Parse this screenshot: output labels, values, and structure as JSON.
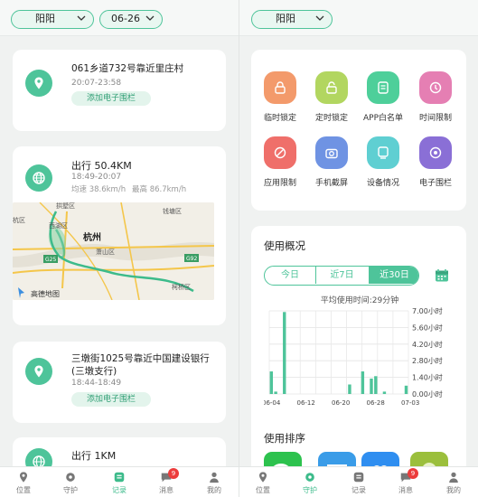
{
  "left": {
    "city": "阳阳",
    "date": "06-26",
    "timeline": [
      {
        "kind": "place",
        "address": "061乡道732号靠近里庄村",
        "time": "20:07-23:58",
        "fence_label": "添加电子围栏"
      },
      {
        "kind": "trip",
        "title": "出行 50.4KM",
        "time": "18:49-20:07",
        "speed_avg": "均速 38.6km/h",
        "speed_max": "最高 86.7km/h",
        "map": {
          "labels": [
            "拱墅区",
            "杭州",
            "西湖区",
            "萧山区",
            "钱塘区",
            "柯桥区",
            "G25",
            "G92"
          ],
          "ghost_labels": [
            "杭区"
          ],
          "logo": "高德地图"
        }
      },
      {
        "kind": "place",
        "address": "三墩街1025号靠近中国建设银行(三墩支行)",
        "time": "18:44-18:49",
        "fence_label": "添加电子围栏"
      },
      {
        "kind": "trip",
        "title": "出行 1KM",
        "time": ""
      }
    ]
  },
  "right": {
    "name": "阳阳",
    "tools": [
      {
        "label": "临时锁定",
        "icon": "lock-icon",
        "color": "#f39a6b"
      },
      {
        "label": "定时锁定",
        "icon": "timed-lock-icon",
        "color": "#b2d660"
      },
      {
        "label": "APP白名单",
        "icon": "whitelist-icon",
        "color": "#4ecf9a"
      },
      {
        "label": "时间限制",
        "icon": "clock-icon",
        "color": "#e57fb3"
      },
      {
        "label": "应用限制",
        "icon": "app-limit-icon",
        "color": "#ef6f6a"
      },
      {
        "label": "手机截屏",
        "icon": "camera-icon",
        "color": "#6f93e3"
      },
      {
        "label": "设备情况",
        "icon": "device-icon",
        "color": "#5fcfd2"
      },
      {
        "label": "电子围栏",
        "icon": "fence-icon",
        "color": "#8a6fd6"
      }
    ],
    "usage": {
      "title": "使用概况",
      "tabs": [
        "今日",
        "近7日",
        "近30日"
      ],
      "active_tab": 2,
      "avg_text": "平均使用时间:29分钟",
      "ranking_title": "使用排序"
    }
  },
  "chart_data": {
    "type": "bar",
    "x_ticks": [
      "06-04",
      "06-12",
      "06-20",
      "06-28",
      "07-03"
    ],
    "y_ticks": [
      "0.00小时",
      "1.40小时",
      "2.80小时",
      "4.20小时",
      "5.60小时",
      "7.00小时"
    ],
    "ylim": [
      0,
      7
    ],
    "values": [
      1.9,
      0.2,
      0,
      6.9,
      0,
      0,
      0,
      0,
      0,
      0,
      0,
      0,
      0,
      0,
      0,
      0,
      0,
      0,
      0.8,
      0,
      0,
      1.9,
      0,
      1.3,
      1.5,
      0,
      0.2,
      0,
      0,
      0,
      0,
      0.7
    ],
    "color": "#4ec49a"
  },
  "nav": {
    "items": [
      "位置",
      "守护",
      "记录",
      "消息",
      "我的"
    ],
    "badge": "9",
    "left_active": 2,
    "right_active": 1
  },
  "colors": {
    "accent": "#4ec49a"
  }
}
